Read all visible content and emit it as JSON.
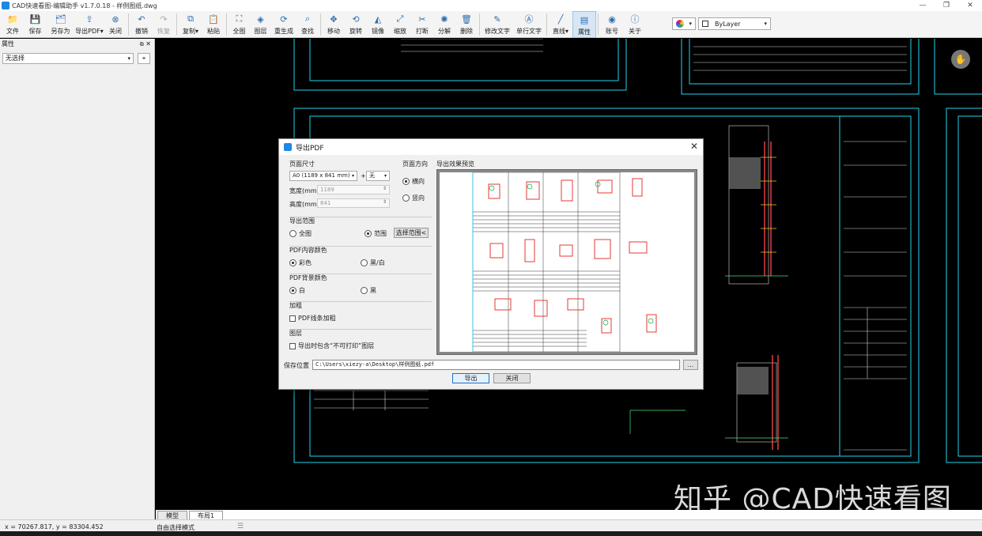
{
  "window": {
    "title": "CAD快速看图-编辑助手 v1.7.0.18 - 样例图纸.dwg",
    "min": "—",
    "max": "❐",
    "close": "✕"
  },
  "toolbar": {
    "buttons": [
      {
        "label": "文件",
        "icon": "folder-icon"
      },
      {
        "label": "保存",
        "icon": "save-icon"
      },
      {
        "label": "另存为",
        "icon": "save-as-icon"
      },
      {
        "label": "导出PDF▾",
        "icon": "export-pdf-icon"
      },
      {
        "label": "关闭",
        "icon": "close-circle-icon"
      },
      {
        "label": "撤销",
        "icon": "undo-icon"
      },
      {
        "label": "恢复",
        "icon": "redo-icon"
      },
      {
        "label": "复制▾",
        "icon": "copy-icon"
      },
      {
        "label": "粘贴",
        "icon": "paste-icon"
      },
      {
        "label": "全图",
        "icon": "fit-all-icon"
      },
      {
        "label": "图层",
        "icon": "layers-icon"
      },
      {
        "label": "重生成",
        "icon": "regen-icon"
      },
      {
        "label": "查找",
        "icon": "find-icon"
      },
      {
        "label": "移动",
        "icon": "move-icon"
      },
      {
        "label": "旋转",
        "icon": "rotate-icon"
      },
      {
        "label": "镜像",
        "icon": "mirror-icon"
      },
      {
        "label": "缩放",
        "icon": "scale-icon"
      },
      {
        "label": "打断",
        "icon": "break-icon"
      },
      {
        "label": "分解",
        "icon": "explode-icon"
      },
      {
        "label": "删除",
        "icon": "delete-icon"
      },
      {
        "label": "修改文字",
        "icon": "edit-text-icon"
      },
      {
        "label": "单行文字",
        "icon": "text-icon"
      },
      {
        "label": "直线▾",
        "icon": "line-icon"
      },
      {
        "label": "属性",
        "icon": "properties-icon"
      },
      {
        "label": "账号",
        "icon": "account-icon"
      },
      {
        "label": "关于",
        "icon": "info-icon"
      }
    ],
    "layer_combo": "ByLayer",
    "color_combo": "▾"
  },
  "left_panel": {
    "header": "属性",
    "pin": "📌",
    "close": "✕",
    "selection": "无选择"
  },
  "layout_tabs": [
    "模型",
    "布局1"
  ],
  "status": {
    "coords": "x = 70267.817, y = 83304.452",
    "mode": "自由选择模式",
    "cmd": "☰"
  },
  "watermark": "知乎 @CAD快速看图",
  "dialog": {
    "title": "导出PDF",
    "close": "✕",
    "page_size_label": "页面尺寸",
    "paper": "A0 (1189 x 841 mm)",
    "plus": "+",
    "margin": "无",
    "width_label": "宽度(mm)",
    "width_value": "1189",
    "height_label": "高度(mm)",
    "height_value": "841",
    "orientation_label": "页面方向",
    "landscape": "横向",
    "portrait": "竖向",
    "preview_label": "导出效果预览",
    "range_label": "导出范围",
    "range_all": "全图",
    "range_window": "范围",
    "select_range": "选择范围<",
    "content_color_label": "PDF内容颜色",
    "color": "彩色",
    "bw": "黑/白",
    "bg_color_label": "PDF背景颜色",
    "white": "白",
    "black": "黑",
    "bold_label": "加粗",
    "bold_option": "PDF线条加粗",
    "layer_label": "图层",
    "layer_option": "导出时包含“不可打印”图层",
    "save_label": "保存位置",
    "save_path": "C:\\Users\\xiezy-a\\Desktop\\样例图纸.pdf",
    "browse": "...",
    "export_btn": "导出",
    "close_btn": "关闭"
  }
}
